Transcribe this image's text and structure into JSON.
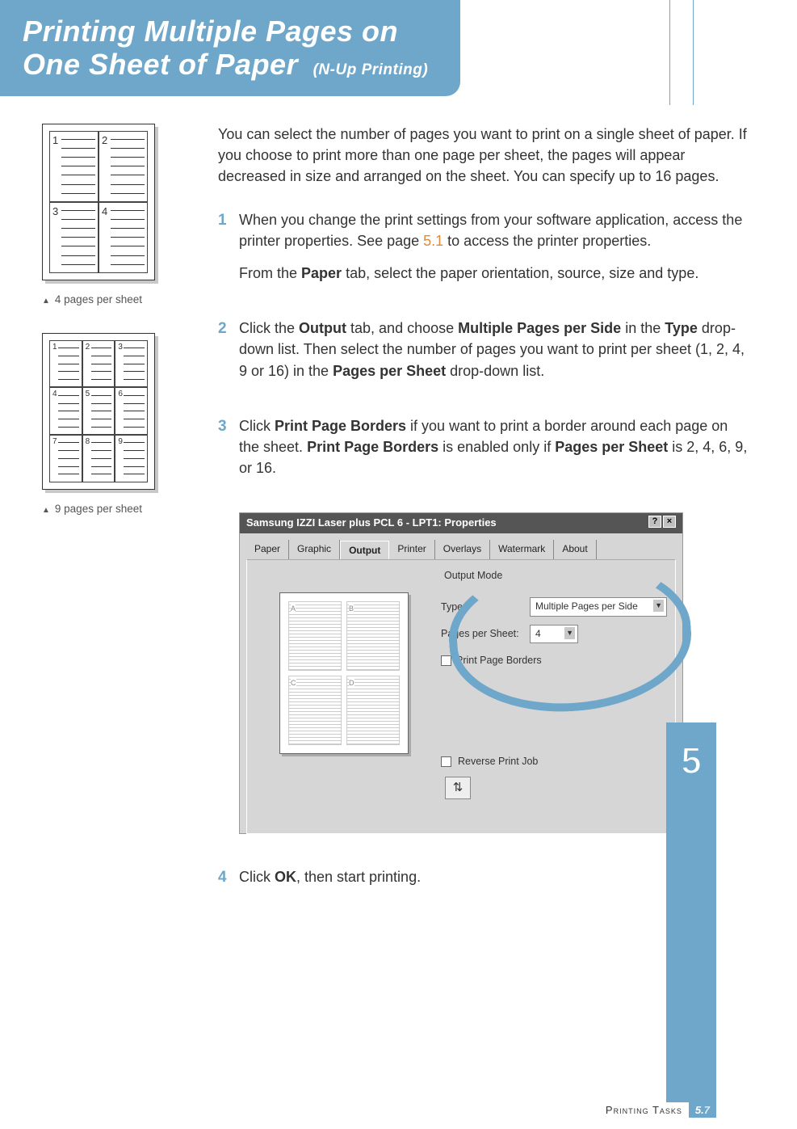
{
  "title": {
    "line": "Printing Multiple Pages on One Sheet of Paper",
    "sub": "(N-Up Printing)"
  },
  "left": {
    "caption4": "4 pages per sheet",
    "caption9": "9 pages per sheet"
  },
  "body": {
    "intro": "You can select the number of pages you want to print on a single sheet of paper. If you choose to print more than one page per sheet, the pages will appear decreased in size and arranged on the sheet. You can specify up to 16 pages.",
    "steps": {
      "s1": {
        "num": "1",
        "p1a": "When you change the print settings from your software application, access the printer properties. See page ",
        "p1link": "5.1",
        "p1b": " to access the printer properties.",
        "p2a": "From the ",
        "p2bold": "Paper",
        "p2b": " tab, select the paper orientation, source, size and type."
      },
      "s2": {
        "num": "2",
        "a": "Click the ",
        "b1": "Output",
        "c": " tab, and choose ",
        "b2": "Multiple Pages per Side",
        "d": " in the ",
        "b3": "Type",
        "e": " drop-down list. Then select the number of pages you want to print per sheet (1, 2, 4, 9 or 16) in the ",
        "b4": "Pages per Sheet",
        "f": " drop-down list."
      },
      "s3": {
        "num": "3",
        "a": "Click ",
        "b1": "Print Page Borders",
        "c": " if you want to print a border around each page on the sheet. ",
        "b2": "Print Page Borders",
        "d": " is enabled only if ",
        "b3": "Pages per Sheet",
        "e": " is 2, 4, 6, 9, or 16."
      },
      "s4": {
        "num": "4",
        "a": "Click ",
        "b1": "OK",
        "c": ", then start printing."
      }
    }
  },
  "screenshot": {
    "title": "Samsung IZZI Laser plus PCL 6 - LPT1: Properties",
    "tabs": [
      "Paper",
      "Graphic",
      "Output",
      "Printer",
      "Overlays",
      "Watermark",
      "About"
    ],
    "group_label": "Output Mode",
    "type_label": "Type:",
    "type_value": "Multiple Pages per Side",
    "pps_label": "Pages per Sheet:",
    "pps_value": "4",
    "border_label": "Print Page Borders",
    "reverse_label": "Reverse Print Job",
    "preview_labels": [
      "A",
      "B",
      "C",
      "D"
    ]
  },
  "side_chapter": "5",
  "footer": {
    "section": "Printing Tasks",
    "page_major": "5.",
    "page_minor": "7"
  }
}
